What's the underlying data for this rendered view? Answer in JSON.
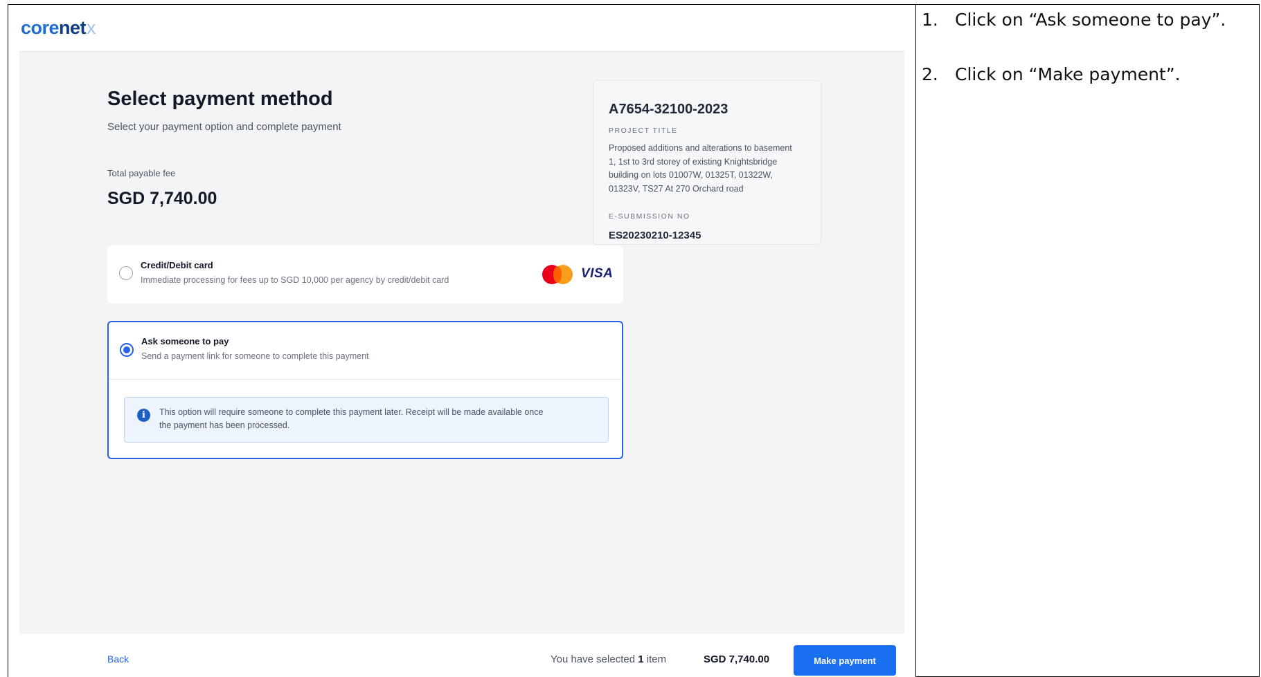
{
  "app": {
    "logo": {
      "part1": "core",
      "part2": "net",
      "mark": "x"
    },
    "title": "Select payment method",
    "subtitle": "Select your payment option and complete payment",
    "fee_label": "Total payable fee",
    "fee_value": "SGD 7,740.00",
    "options": [
      {
        "title": "Credit/Debit card",
        "description": "Immediate processing for fees up to SGD 10,000 per agency by credit/debit card",
        "selected": false,
        "brands": [
          "mastercard-icon",
          "VISA"
        ]
      },
      {
        "title": "Ask someone to pay",
        "description": "Send a payment link for someone to complete this payment",
        "selected": true,
        "info": "This option will require someone to complete this payment later. Receipt will be made available once the payment has been processed."
      }
    ],
    "summary": {
      "reference": "A7654-32100-2023",
      "project_title_label": "PROJECT TITLE",
      "project_title": "Proposed additions and alterations to basement 1, 1st to 3rd storey of existing Knightsbridge building on lots 01007W, 01325T, 01322W, 01323V, TS27 At 270 Orchard road",
      "submission_label": "E-SUBMISSION NO",
      "submission_no": "ES20230210-12345"
    },
    "footer": {
      "back": "Back",
      "selected_prefix": "You have selected",
      "selected_count": "1",
      "selected_suffix": "item",
      "total": "SGD 7,740.00",
      "pay_button": "Make payment"
    },
    "colors": {
      "accent": "#2563eb",
      "button": "#1a6ff0",
      "background": "#f3f4f6"
    }
  },
  "instructions": [
    {
      "number": "1.",
      "text": "Click on “Ask someone to pay”."
    },
    {
      "number": "2.",
      "text": "Click on “Make payment”."
    }
  ]
}
